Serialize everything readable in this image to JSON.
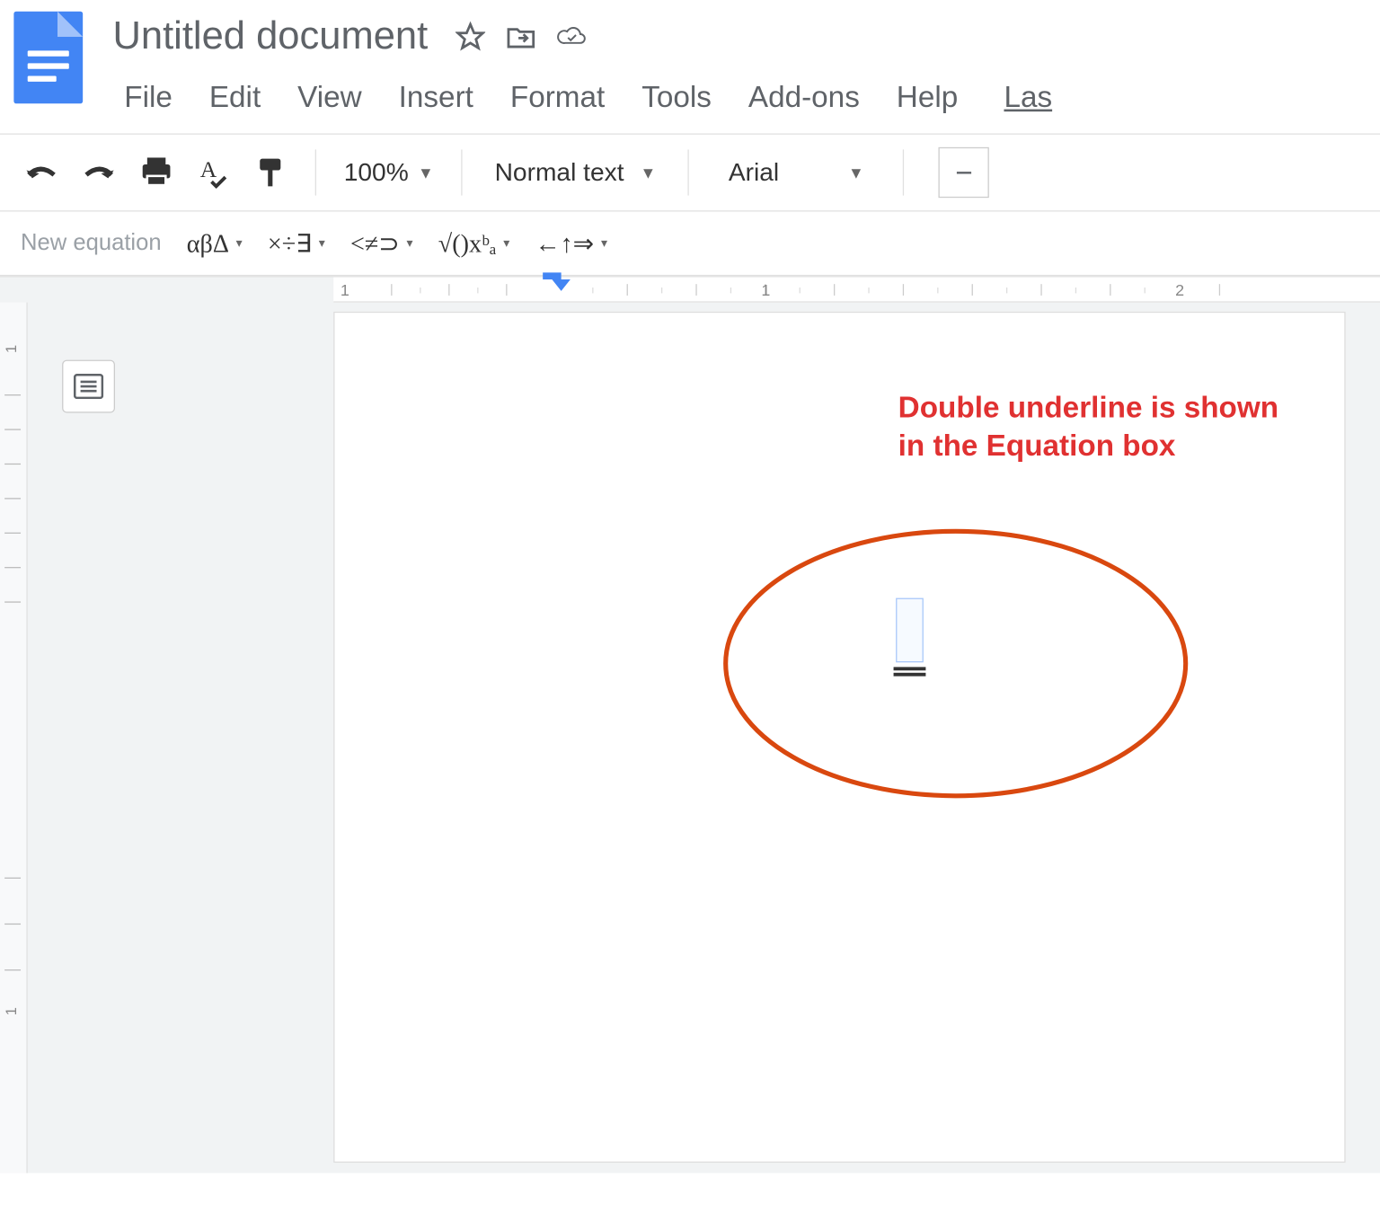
{
  "header": {
    "title": "Untitled document",
    "menus": [
      "File",
      "Edit",
      "View",
      "Insert",
      "Format",
      "Tools",
      "Add-ons",
      "Help"
    ],
    "last_label": "Las"
  },
  "toolbar": {
    "zoom": "100%",
    "style": "Normal text",
    "font": "Arial"
  },
  "equation_toolbar": {
    "new_label": "New equation",
    "greek": "αβΔ",
    "ops": "×÷∃",
    "rel": "<≠⊃",
    "math": "√()xᵇₐ",
    "arrows": "←↑⇒"
  },
  "ruler": {
    "num1": "1",
    "num2": "1",
    "num3": "2"
  },
  "vruler": {
    "n1": "1",
    "n2": "1"
  },
  "annotation": "Double underline is shown in the Equation box"
}
